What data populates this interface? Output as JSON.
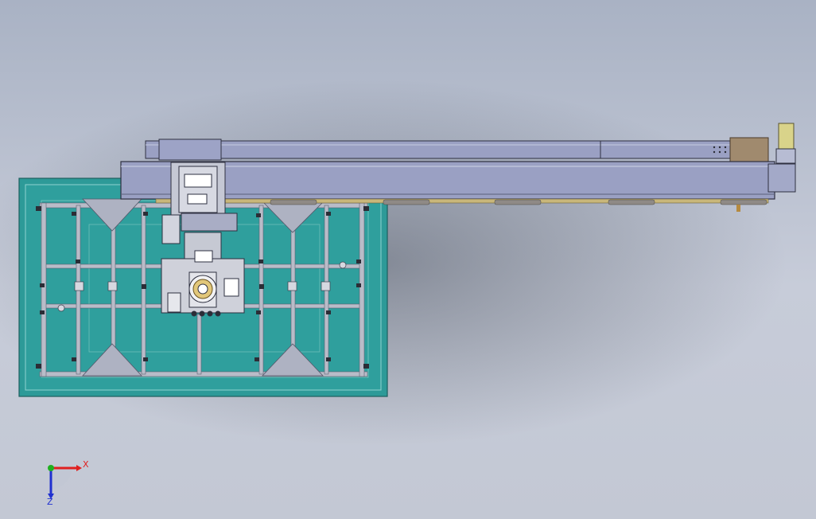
{
  "viewport": {
    "background_top": "#a9b2c4",
    "background_mid": "#c7ccd9",
    "background_bottom": "#c3c8d4",
    "base_color": "#2d9a98",
    "base_inner": "#2f9f9d",
    "frame_color": "#b9bcc8",
    "rail_color": "#9aa0c3",
    "rail_dark": "#3c3c56",
    "gantry_accent": "#a08a6e",
    "bar_yellow": "#c9b77a",
    "motor_yellow": "#d9d38a"
  },
  "triad": {
    "x_label": "X",
    "z_label": "Z",
    "x_color": "#e02020",
    "y_color": "#20b020",
    "z_color": "#2030d0"
  }
}
